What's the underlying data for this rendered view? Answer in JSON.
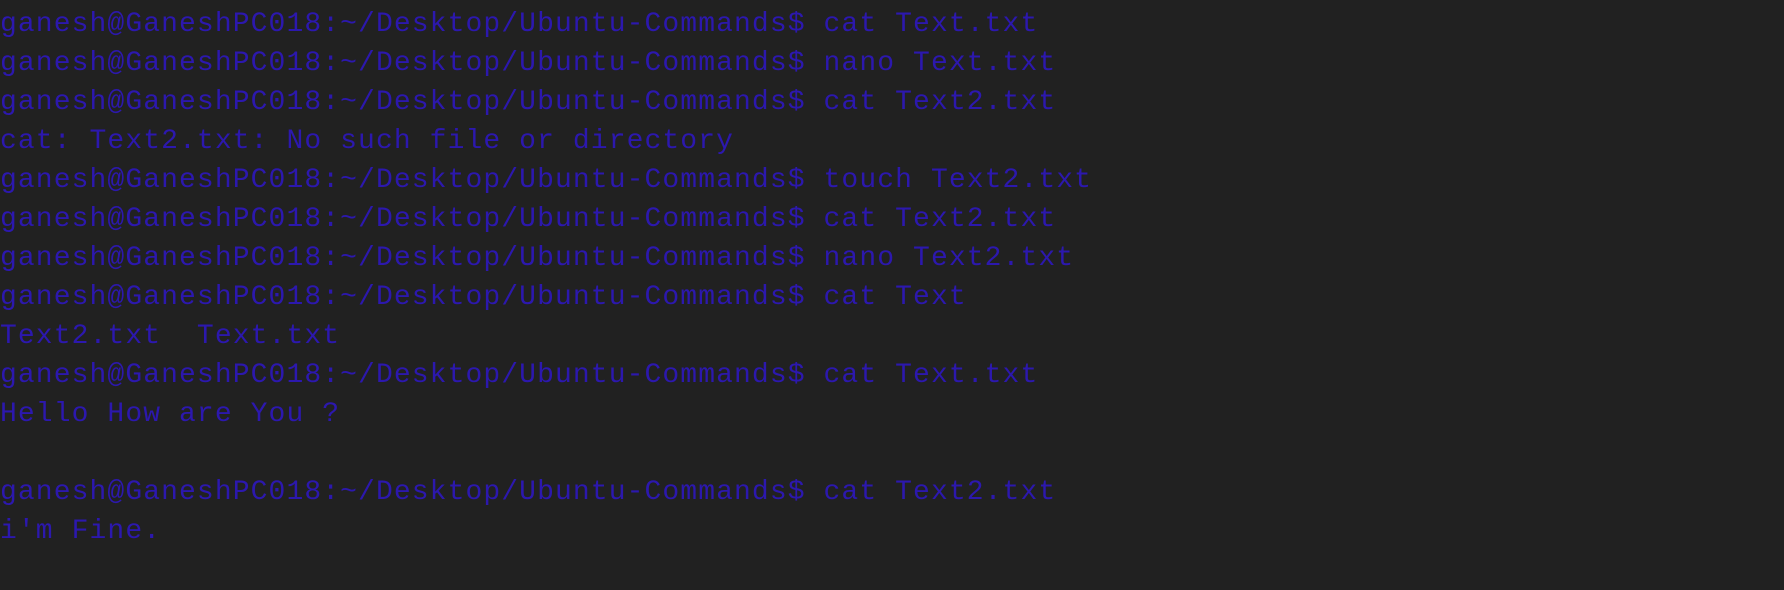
{
  "terminal": {
    "text_color": "#2c18ae",
    "background_color": "#212121",
    "lines": [
      "ganesh@GaneshPC018:~/Desktop/Ubuntu-Commands$ cat Text.txt",
      "ganesh@GaneshPC018:~/Desktop/Ubuntu-Commands$ nano Text.txt",
      "ganesh@GaneshPC018:~/Desktop/Ubuntu-Commands$ cat Text2.txt",
      "cat: Text2.txt: No such file or directory",
      "ganesh@GaneshPC018:~/Desktop/Ubuntu-Commands$ touch Text2.txt",
      "ganesh@GaneshPC018:~/Desktop/Ubuntu-Commands$ cat Text2.txt",
      "ganesh@GaneshPC018:~/Desktop/Ubuntu-Commands$ nano Text2.txt",
      "ganesh@GaneshPC018:~/Desktop/Ubuntu-Commands$ cat Text",
      "Text2.txt  Text.txt",
      "ganesh@GaneshPC018:~/Desktop/Ubuntu-Commands$ cat Text.txt",
      "Hello How are You ?",
      "",
      "ganesh@GaneshPC018:~/Desktop/Ubuntu-Commands$ cat Text2.txt",
      "i'm Fine."
    ]
  }
}
